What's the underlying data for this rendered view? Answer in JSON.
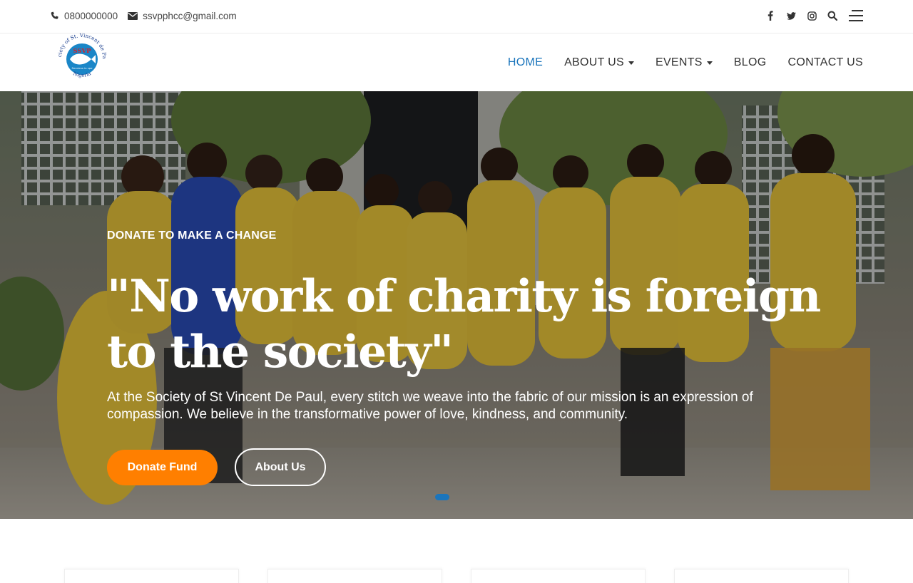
{
  "topbar": {
    "phone": "0800000000",
    "email": "ssvpphcc@gmail.com",
    "social_icons": [
      "facebook-icon",
      "twitter-icon",
      "instagram-icon",
      "search-icon",
      "hamburger-menu-icon"
    ]
  },
  "logo": {
    "top_text": "Society of St. Vincent de Paul",
    "badge_text": "SSVP",
    "motto": "Serviens in spe",
    "bottom_text": "Nigeria"
  },
  "nav": {
    "home": "HOME",
    "about": "ABOUT US",
    "events": "EVENTS",
    "blog": "BLOG",
    "contact": "CONTACT US"
  },
  "hero": {
    "kicker": "DONATE TO MAKE A CHANGE",
    "headline": "\"No work of charity is foreign to the society\"",
    "description": "At the Society of St Vincent De Paul, every stitch we weave into the fabric of our mission is an expression of compassion. We believe in the transformative power of love, kindness, and community.",
    "primary_button": "Donate Fund",
    "secondary_button": "About Us"
  },
  "colors": {
    "accent_blue": "#1b75bc",
    "donate_orange": "#ff7f00",
    "shirt_yellow": "#e8c43a"
  }
}
